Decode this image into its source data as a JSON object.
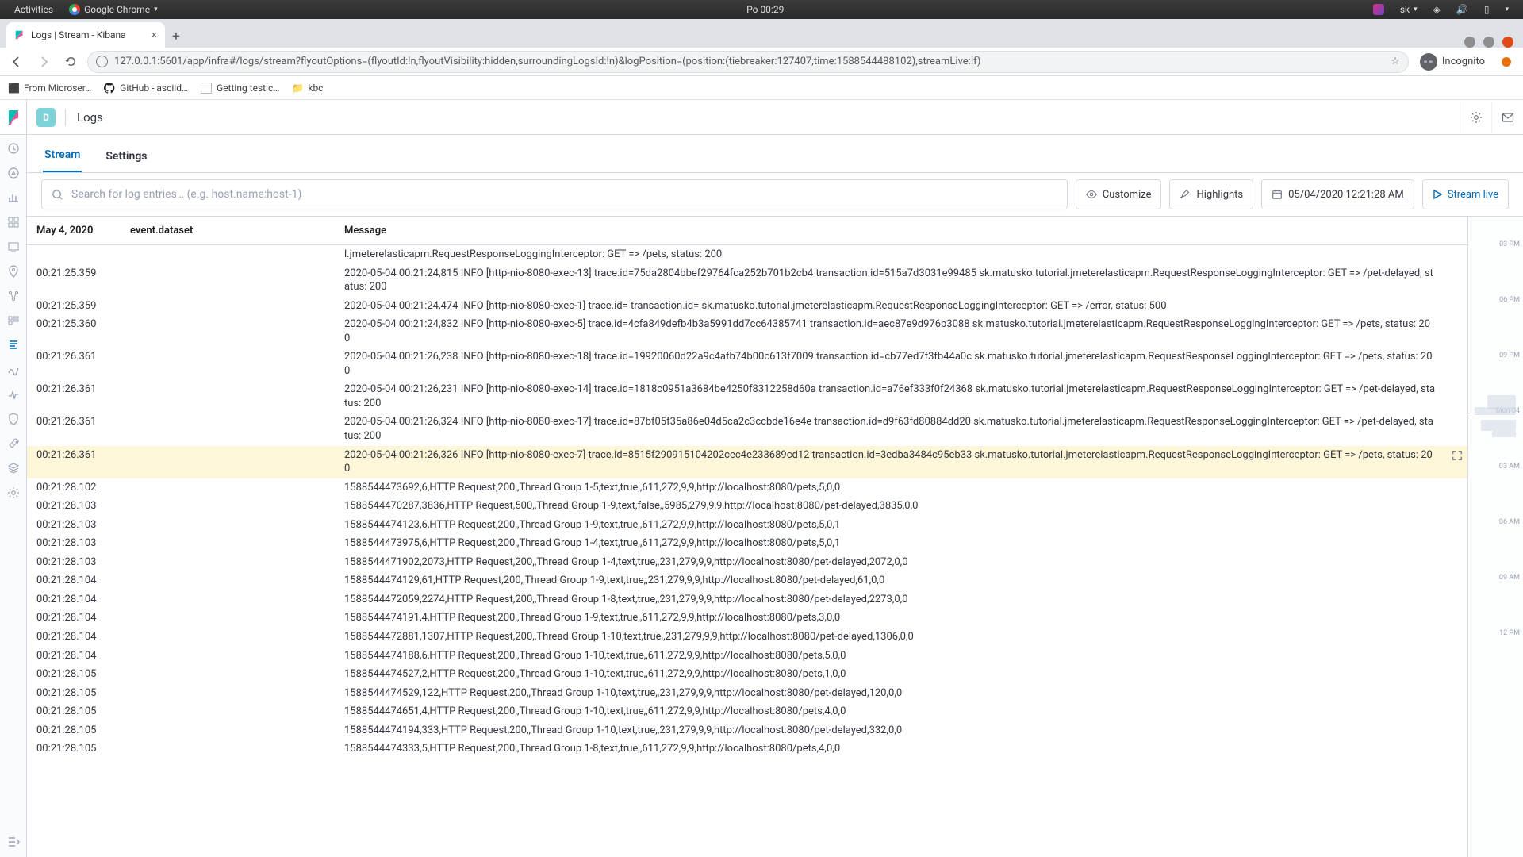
{
  "os": {
    "activities": "Activities",
    "browser": "Google Chrome",
    "clock": "Po 00:29",
    "lang": "sk"
  },
  "tab": {
    "title": "Logs | Stream - Kibana"
  },
  "address_bar": {
    "url": "127.0.0.1:5601/app/infra#/logs/stream?flyoutOptions=(flyoutId:!n,flyoutVisibility:hidden,surroundingLogsId:!n)&logPosition=(position:(tiebreaker:127407,time:1588544488102),streamLive:!f)",
    "incognito": "Incognito"
  },
  "bookmarks": {
    "b1": "From Microser…",
    "b2": "GitHub - asciid…",
    "b3": "Getting test c…",
    "b4": "kbc"
  },
  "header": {
    "space": "D",
    "title": "Logs"
  },
  "tabs": {
    "stream": "Stream",
    "settings": "Settings"
  },
  "toolbar": {
    "search_placeholder": "Search for log entries… (e.g. host.name:host-1)",
    "customize": "Customize",
    "highlights": "Highlights",
    "date": "05/04/2020 12:21:28 AM",
    "stream_live": "Stream live"
  },
  "columns": {
    "date": "May 4, 2020",
    "dataset": "event.dataset",
    "message": "Message"
  },
  "rows": [
    {
      "ts": "",
      "msg": "l.jmeterelasticapm.RequestResponseLoggingInterceptor: GET => /pets, status: 200"
    },
    {
      "ts": "00:21:25.359",
      "msg": "2020-05-04 00:21:24,815 INFO [http-nio-8080-exec-13] trace.id=75da2804bbef29764fca252b701b2cb4 transaction.id=515a7d3031e99485 sk.matusko.tutorial.jmeterelasticapm.RequestResponseLoggingInterceptor: GET => /pet-delayed, status: 200"
    },
    {
      "ts": "00:21:25.359",
      "msg": "2020-05-04 00:21:24,474 INFO [http-nio-8080-exec-1] trace.id= transaction.id= sk.matusko.tutorial.jmeterelasticapm.RequestResponseLoggingInterceptor: GET => /error, status: 500"
    },
    {
      "ts": "00:21:25.360",
      "msg": "2020-05-04 00:21:24,832 INFO [http-nio-8080-exec-5] trace.id=4cfa849defb4b3a5991dd7cc64385741 transaction.id=aec87e9d976b3088 sk.matusko.tutorial.jmeterelasticapm.RequestResponseLoggingInterceptor: GET => /pets, status: 200"
    },
    {
      "ts": "00:21:26.361",
      "msg": "2020-05-04 00:21:26,238 INFO [http-nio-8080-exec-18] trace.id=19920060d22a9c4afb74b00c613f7009 transaction.id=cb77ed7f3fb44a0c sk.matusko.tutorial.jmeterelasticapm.RequestResponseLoggingInterceptor: GET => /pets, status: 200"
    },
    {
      "ts": "00:21:26.361",
      "msg": "2020-05-04 00:21:26,231 INFO [http-nio-8080-exec-14] trace.id=1818c0951a3684be4250f8312258d60a transaction.id=a76ef333f0f24368 sk.matusko.tutorial.jmeterelasticapm.RequestResponseLoggingInterceptor: GET => /pet-delayed, status: 200"
    },
    {
      "ts": "00:21:26.361",
      "msg": "2020-05-04 00:21:26,324 INFO [http-nio-8080-exec-17] trace.id=87bf05f35a86e04d5ca2c3ccbde16e4e transaction.id=d9f63fd80884dd20 sk.matusko.tutorial.jmeterelasticapm.RequestResponseLoggingInterceptor: GET => /pet-delayed, status: 200"
    },
    {
      "ts": "00:21:26.361",
      "hl": true,
      "msg": "2020-05-04 00:21:26,326 INFO [http-nio-8080-exec-7] trace.id=8515f290915104202cec4e233689cd12 transaction.id=3edba3484c95eb33 sk.matusko.tutorial.jmeterelasticapm.RequestResponseLoggingInterceptor: GET => /pets, status: 200"
    },
    {
      "ts": "00:21:28.102",
      "msg": "1588544473692,6,HTTP Request,200,,Thread Group 1-5,text,true,,611,272,9,9,http://localhost:8080/pets,5,0,0"
    },
    {
      "ts": "00:21:28.103",
      "msg": "1588544470287,3836,HTTP Request,500,,Thread Group 1-9,text,false,,5985,279,9,9,http://localhost:8080/pet-delayed,3835,0,0"
    },
    {
      "ts": "00:21:28.103",
      "msg": "1588544474123,6,HTTP Request,200,,Thread Group 1-9,text,true,,611,272,9,9,http://localhost:8080/pets,5,0,1"
    },
    {
      "ts": "00:21:28.103",
      "msg": "1588544473975,6,HTTP Request,200,,Thread Group 1-4,text,true,,611,272,9,9,http://localhost:8080/pets,5,0,1"
    },
    {
      "ts": "00:21:28.103",
      "msg": "1588544471902,2073,HTTP Request,200,,Thread Group 1-4,text,true,,231,279,9,9,http://localhost:8080/pet-delayed,2072,0,0"
    },
    {
      "ts": "00:21:28.104",
      "msg": "1588544474129,61,HTTP Request,200,,Thread Group 1-9,text,true,,231,279,9,9,http://localhost:8080/pet-delayed,61,0,0"
    },
    {
      "ts": "00:21:28.104",
      "msg": "1588544472059,2274,HTTP Request,200,,Thread Group 1-8,text,true,,231,279,9,9,http://localhost:8080/pet-delayed,2273,0,0"
    },
    {
      "ts": "00:21:28.104",
      "msg": "1588544474191,4,HTTP Request,200,,Thread Group 1-9,text,true,,611,272,9,9,http://localhost:8080/pets,3,0,0"
    },
    {
      "ts": "00:21:28.104",
      "msg": "1588544472881,1307,HTTP Request,200,,Thread Group 1-10,text,true,,231,279,9,9,http://localhost:8080/pet-delayed,1306,0,0"
    },
    {
      "ts": "00:21:28.104",
      "msg": "1588544474188,6,HTTP Request,200,,Thread Group 1-10,text,true,,611,272,9,9,http://localhost:8080/pets,5,0,0"
    },
    {
      "ts": "00:21:28.105",
      "msg": "1588544474527,2,HTTP Request,200,,Thread Group 1-10,text,true,,611,272,9,9,http://localhost:8080/pets,1,0,0"
    },
    {
      "ts": "00:21:28.105",
      "msg": "1588544474529,122,HTTP Request,200,,Thread Group 1-10,text,true,,231,279,9,9,http://localhost:8080/pet-delayed,120,0,0"
    },
    {
      "ts": "00:21:28.105",
      "msg": "1588544474651,4,HTTP Request,200,,Thread Group 1-10,text,true,,611,272,9,9,http://localhost:8080/pets,4,0,0"
    },
    {
      "ts": "00:21:28.105",
      "msg": "1588544474194,333,HTTP Request,200,,Thread Group 1-10,text,true,,231,279,9,9,http://localhost:8080/pet-delayed,332,0,0"
    },
    {
      "ts": "00:21:28.105",
      "msg": "1588544474333,5,HTTP Request,200,,Thread Group 1-8,text,true,,611,272,9,9,http://localhost:8080/pets,4,0,0"
    }
  ],
  "minimap": {
    "ticks": [
      "03 PM",
      "06 PM",
      "09 PM",
      "Mon 04",
      "03 AM",
      "06 AM",
      "09 AM",
      "12 PM"
    ]
  }
}
